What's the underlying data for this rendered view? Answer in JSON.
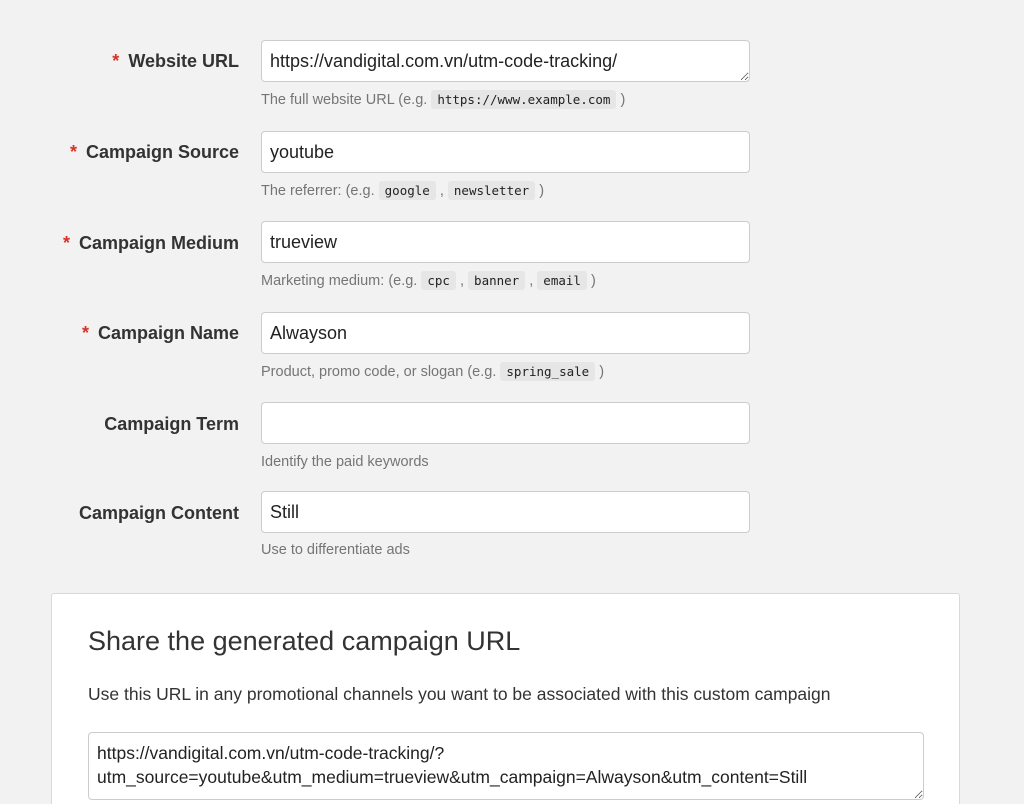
{
  "fields": [
    {
      "label": "Website URL",
      "required_marker": "*",
      "value": "https://vandigital.com.vn/utm-code-tracking/",
      "hint": {
        "prefix": "The full website URL (e.g. ",
        "codes": [
          "https://www.example.com"
        ],
        "suffix": ")"
      }
    },
    {
      "label": "Campaign Source",
      "required_marker": "*",
      "value": "youtube",
      "hint": {
        "prefix": "The referrer: (e.g. ",
        "codes": [
          "google",
          "newsletter"
        ],
        "suffix": ")"
      }
    },
    {
      "label": "Campaign Medium",
      "required_marker": "*",
      "value": "trueview",
      "hint": {
        "prefix": "Marketing medium: (e.g. ",
        "codes": [
          "cpc",
          "banner",
          "email"
        ],
        "suffix": ")"
      }
    },
    {
      "label": "Campaign Name",
      "required_marker": "*",
      "value": "Alwayson",
      "hint": {
        "prefix": "Product, promo code, or slogan (e.g. ",
        "codes": [
          "spring_sale"
        ],
        "suffix": ")"
      }
    },
    {
      "label": "Campaign Term",
      "required_marker": "",
      "value": "",
      "hint": {
        "text": "Identify the paid keywords"
      }
    },
    {
      "label": "Campaign Content",
      "required_marker": "",
      "value": "Still",
      "hint": {
        "text": "Use to differentiate ads"
      }
    }
  ],
  "share": {
    "title": "Share the generated campaign URL",
    "description": "Use this URL in any promotional channels you want to be associated with this custom campaign",
    "generated_url": "https://vandigital.com.vn/utm-code-tracking/?utm_source=youtube&utm_medium=trueview&utm_campaign=Alwayson&utm_content=Still",
    "generated_url_display_line1": "https://vandigital.com.vn/utm-code-tracking/?",
    "generated_url_display_line2": "utm_source=youtube&utm_medium=trueview&utm_campaign=Alwayson&utm_content=Still"
  },
  "colors": {
    "required": "#d93025",
    "background": "#f2f2f2",
    "hint_text": "#757575"
  }
}
